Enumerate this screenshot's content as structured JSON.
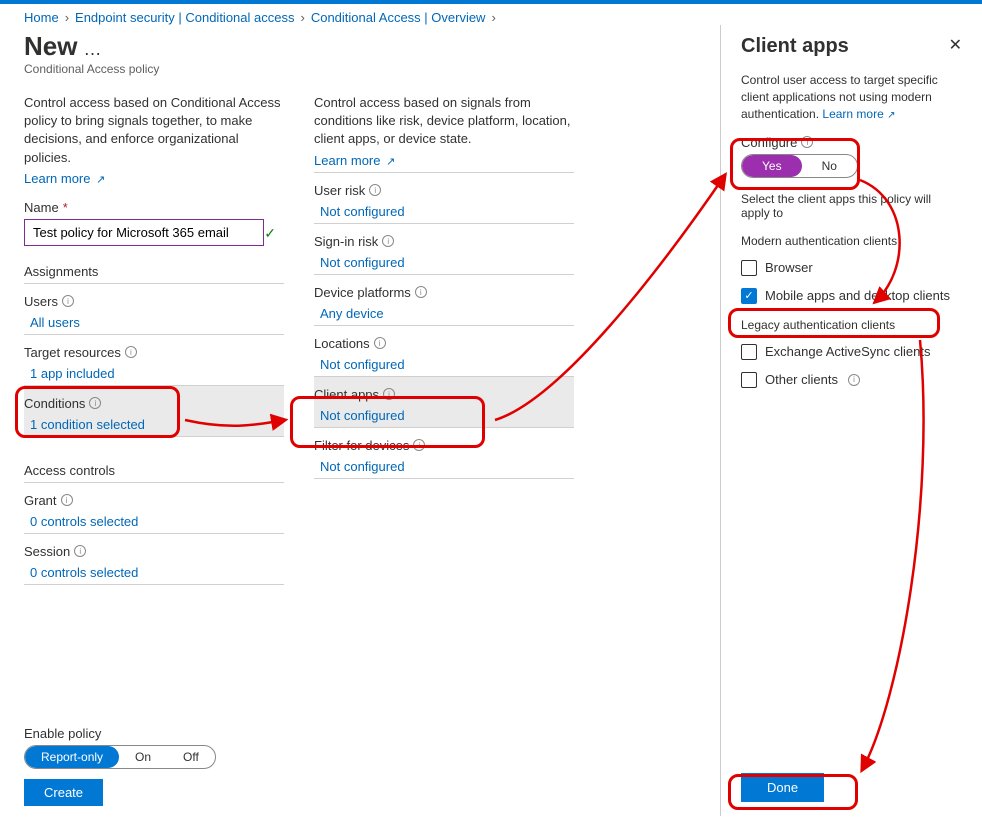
{
  "breadcrumb": [
    "Home",
    "Endpoint security | Conditional access",
    "Conditional Access | Overview"
  ],
  "page_title": "New",
  "page_subtitle": "Conditional Access policy",
  "col1": {
    "desc": "Control access based on Conditional Access policy to bring signals together, to make decisions, and enforce organizational policies.",
    "learn": "Learn more",
    "name_label": "Name",
    "name_value": "Test policy for Microsoft 365 email",
    "assignments_title": "Assignments",
    "users_label": "Users",
    "users_value": "All users",
    "resources_label": "Target resources",
    "resources_value": "1 app included",
    "conditions_label": "Conditions",
    "conditions_value": "1 condition selected",
    "access_title": "Access controls",
    "grant_label": "Grant",
    "grant_value": "0 controls selected",
    "session_label": "Session",
    "session_value": "0 controls selected"
  },
  "col2": {
    "desc": "Control access based on signals from conditions like risk, device platform, location, client apps, or device state.",
    "learn": "Learn more",
    "items": [
      {
        "label": "User risk",
        "value": "Not configured"
      },
      {
        "label": "Sign-in risk",
        "value": "Not configured"
      },
      {
        "label": "Device platforms",
        "value": "Any device"
      },
      {
        "label": "Locations",
        "value": "Not configured"
      },
      {
        "label": "Client apps",
        "value": "Not configured"
      },
      {
        "label": "Filter for devices",
        "value": "Not configured"
      }
    ]
  },
  "footer": {
    "enable_label": "Enable policy",
    "opts": [
      "Report-only",
      "On",
      "Off"
    ],
    "create": "Create"
  },
  "panel": {
    "title": "Client apps",
    "desc": "Control user access to target specific client applications not using modern authentication.",
    "learn": "Learn more",
    "configure_label": "Configure",
    "yes": "Yes",
    "no": "No",
    "select_text": "Select the client apps this policy will apply to",
    "group_modern": "Modern authentication clients",
    "browser": "Browser",
    "mobile": "Mobile apps and desktop clients",
    "group_legacy": "Legacy authentication clients",
    "eas": "Exchange ActiveSync clients",
    "other": "Other clients",
    "done": "Done"
  }
}
